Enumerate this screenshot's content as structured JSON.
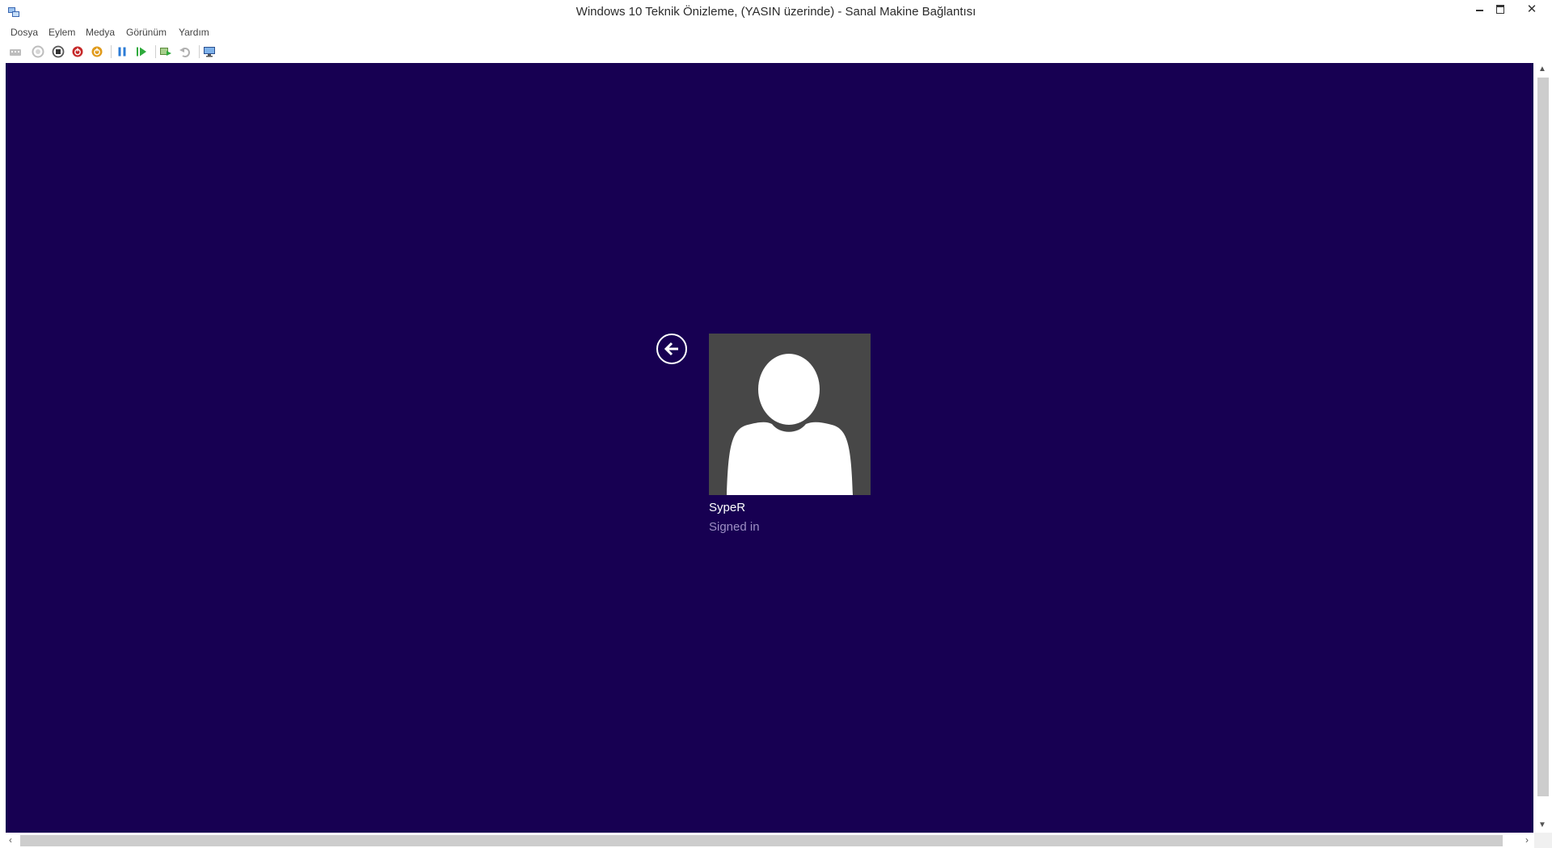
{
  "window": {
    "title": "Windows 10 Teknik Önizleme, (YASIN üzerinde) - Sanal Makine Bağlantısı",
    "minimize_label": "",
    "maximize_label": "",
    "close_label": "✕"
  },
  "menu": {
    "items": [
      "Dosya",
      "Eylem",
      "Medya",
      "Görünüm",
      "Yardım"
    ]
  },
  "toolbar": {
    "buttons": [
      "ctrl-alt-del-icon",
      "start-icon",
      "turn-off-icon",
      "shut-down-icon",
      "save-icon",
      "pause-icon",
      "resume-icon",
      "checkpoint-icon",
      "revert-icon",
      "enhanced-session-icon"
    ]
  },
  "login": {
    "user_name": "SypeR",
    "status": "Signed in"
  },
  "colors": {
    "background": "#170052",
    "avatar_tile": "#474747",
    "status_text": "#9d8fc4"
  }
}
